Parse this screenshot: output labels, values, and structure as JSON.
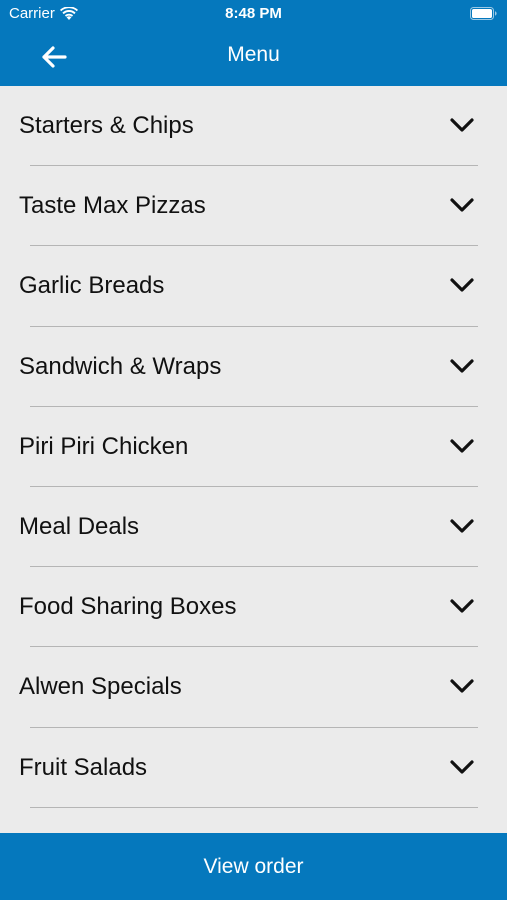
{
  "status_bar": {
    "carrier": "Carrier",
    "time": "8:48 PM"
  },
  "nav": {
    "title": "Menu",
    "back_icon": "arrow-left-icon"
  },
  "menu": {
    "items": [
      {
        "label": "Starters & Chips"
      },
      {
        "label": "Taste Max Pizzas"
      },
      {
        "label": "Garlic Breads"
      },
      {
        "label": "Sandwich & Wraps"
      },
      {
        "label": "Piri Piri Chicken"
      },
      {
        "label": "Meal Deals"
      },
      {
        "label": "Food Sharing Boxes"
      },
      {
        "label": "Alwen Specials"
      },
      {
        "label": "Fruit Salads"
      }
    ],
    "expand_icon": "chevron-down-icon"
  },
  "footer": {
    "view_order_label": "View order"
  },
  "colors": {
    "brand": "#0578bd",
    "background": "#ebebeb",
    "divider": "#b5b5b5"
  }
}
